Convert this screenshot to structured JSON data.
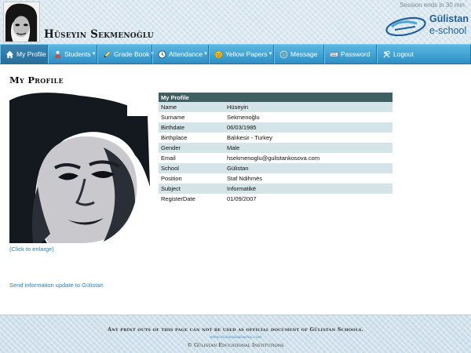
{
  "header": {
    "user_name": "Hüseyin Sekmenoğlu",
    "session_text": "Session ends in 30 min.",
    "brand_name": "Gülistan",
    "brand_sub": "e-school"
  },
  "nav": {
    "items": [
      {
        "label": "My Profile",
        "icon": "home-icon",
        "dropdown": false,
        "active": true
      },
      {
        "label": "Students",
        "icon": "students-icon",
        "dropdown": true
      },
      {
        "label": "Grade Book",
        "icon": "pencil-icon",
        "dropdown": true
      },
      {
        "label": "Attendance",
        "icon": "clock-icon",
        "dropdown": true
      },
      {
        "label": "Yellow Papers",
        "icon": "yellow-papers-icon",
        "dropdown": true
      },
      {
        "label": "Message",
        "icon": "globe-icon",
        "dropdown": false
      },
      {
        "label": "Password",
        "icon": "keyboard-icon",
        "dropdown": false
      },
      {
        "label": "Logout",
        "icon": "tools-icon",
        "dropdown": false
      }
    ]
  },
  "main": {
    "page_title": "My Profile",
    "enlarge_link": "(Click to enlarge)",
    "update_link": "Send information update to Gülistan",
    "profile_table": {
      "header": "My Profile",
      "rows": [
        {
          "label": "Name",
          "value": "Hüseyin"
        },
        {
          "label": "Surname",
          "value": "Sekmenoğlu"
        },
        {
          "label": "Birthdate",
          "value": "06/03/1985"
        },
        {
          "label": "Birthplace",
          "value": "Balıkesir - Turkey"
        },
        {
          "label": "Gender",
          "value": "Male"
        },
        {
          "label": "Email",
          "value": "hsekmenoglu@gulistankosova.com"
        },
        {
          "label": "School",
          "value": "Gülistan"
        },
        {
          "label": "Position",
          "value": "Staf Ndihmës"
        },
        {
          "label": "Subject",
          "value": "Informatikë"
        },
        {
          "label": "RegisterDate",
          "value": "01/09/2007"
        }
      ]
    }
  },
  "footer": {
    "note": "Any print outs of this page can not be used as official document of Gülistan Schools.",
    "link": "www.gulistankosova.com",
    "copyright": "© Gülistan Educational Institutions"
  },
  "colors": {
    "nav_bg": "#3ea3d6",
    "table_header_bg": "#3f5f63",
    "table_row_alt": "#d4e4e9",
    "link": "#2f7fbf",
    "brand": "#1f5f98"
  }
}
